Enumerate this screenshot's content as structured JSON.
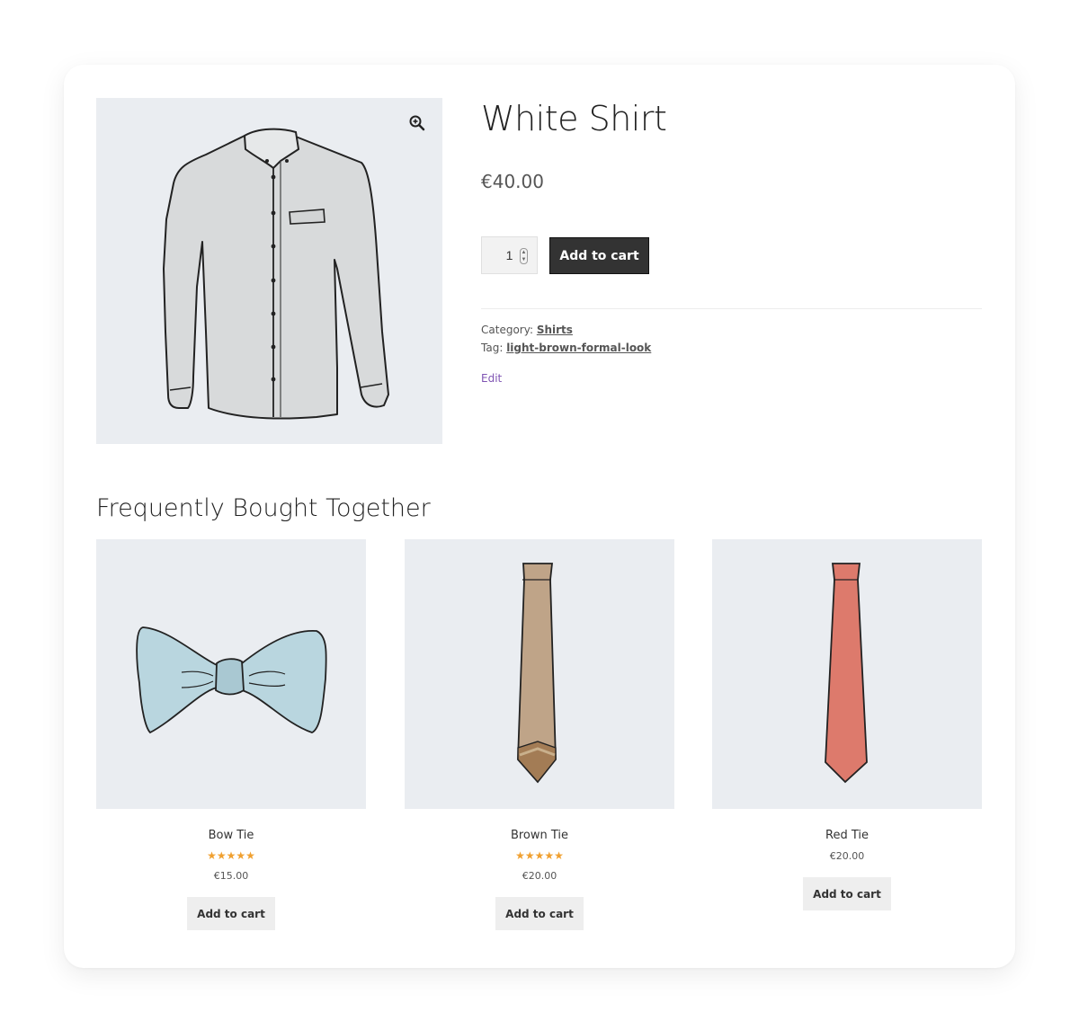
{
  "product": {
    "title": "White Shirt",
    "price": "€40.00",
    "quantity": "1",
    "add_to_cart": "Add to cart",
    "category_label": "Category:",
    "category": "Shirts",
    "tag_label": "Tag:",
    "tag": "light-brown-formal-look",
    "edit": "Edit"
  },
  "section_title": "Frequently Bought Together",
  "related": [
    {
      "name": "Bow Tie",
      "stars": "★★★★★",
      "price": "€15.00",
      "button": "Add to cart"
    },
    {
      "name": "Brown Tie",
      "stars": "★★★★★",
      "price": "€20.00",
      "button": "Add to cart"
    },
    {
      "name": "Red Tie",
      "price": "€20.00",
      "button": "Add to cart"
    }
  ],
  "colors": {
    "image_bg": "#eaedf1",
    "button_dark": "#333333",
    "star": "#f0a030",
    "edit_link": "#7f54b3",
    "bowtie": "#b9d6df",
    "brown_tie": "#bfa488",
    "red_tie": "#dd7a6c"
  }
}
